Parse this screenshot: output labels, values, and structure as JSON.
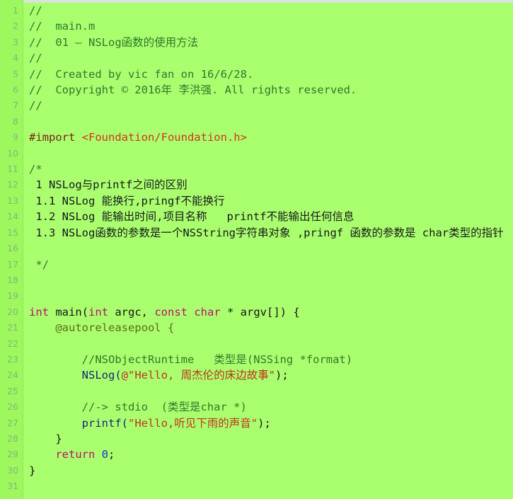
{
  "app": {
    "kind": "code-editor",
    "language": "Objective-C",
    "filename": "main.m"
  },
  "theme": {
    "background": "#aaff6e",
    "gutter_background": "#9cf85c",
    "gutter_rule": "#8fe854",
    "line_number_color": "#86b581",
    "top_strip": "#d9e3da",
    "comment": "#2b7a2b",
    "block_doc_text": "#16181a",
    "preprocessor": "#7a1f12",
    "header_path": "#d2341a",
    "keyword": "#b5116b",
    "function": "#13277a",
    "string": "#c0321c",
    "at_directive": "#5c6b18",
    "number": "#1232c8",
    "plain": "#141414"
  },
  "editor": {
    "first_visible_line": 1,
    "last_visible_line": 31,
    "lines": [
      {
        "n": "1",
        "tokens": [
          {
            "c": "t-comment",
            "t": "//"
          }
        ]
      },
      {
        "n": "2",
        "tokens": [
          {
            "c": "t-comment",
            "t": "//  main.m"
          }
        ]
      },
      {
        "n": "3",
        "tokens": [
          {
            "c": "t-comment",
            "t": "//  01 – NSLog函数的使用方法"
          }
        ]
      },
      {
        "n": "4",
        "tokens": [
          {
            "c": "t-comment",
            "t": "//"
          }
        ]
      },
      {
        "n": "5",
        "tokens": [
          {
            "c": "t-comment",
            "t": "//  Created by vic fan on 16/6/28."
          }
        ]
      },
      {
        "n": "6",
        "tokens": [
          {
            "c": "t-comment",
            "t": "//  Copyright © 2016年 李洪强. All rights reserved."
          }
        ]
      },
      {
        "n": "7",
        "tokens": [
          {
            "c": "t-comment",
            "t": "//"
          }
        ]
      },
      {
        "n": "8",
        "tokens": []
      },
      {
        "n": "9",
        "tokens": [
          {
            "c": "t-pre",
            "t": "#import "
          },
          {
            "c": "t-hdr",
            "t": "<Foundation/Foundation.h>"
          }
        ]
      },
      {
        "n": "10",
        "tokens": []
      },
      {
        "n": "11",
        "tokens": [
          {
            "c": "t-comment",
            "t": "/*"
          }
        ]
      },
      {
        "n": "12",
        "tokens": [
          {
            "c": "t-blockdoc",
            "t": " 1 NSLog与printf之间的区别"
          }
        ]
      },
      {
        "n": "13",
        "tokens": [
          {
            "c": "t-blockdoc",
            "t": " 1.1 NSLog 能换行,pringf不能换行"
          }
        ]
      },
      {
        "n": "14",
        "tokens": [
          {
            "c": "t-blockdoc",
            "t": " 1.2 NSLog 能输出时间,项目名称   printf不能输出任何信息"
          }
        ]
      },
      {
        "n": "15",
        "tokens": [
          {
            "c": "t-blockdoc",
            "t": " 1.3 NSLog函数的参数是一个NSString字符串对象 ,pringf 函数的参数是 char类型的指针"
          }
        ],
        "wraps": true
      },
      {
        "n": "16",
        "tokens": []
      },
      {
        "n": "17",
        "tokens": [
          {
            "c": "t-comment",
            "t": " */"
          }
        ]
      },
      {
        "n": "18",
        "tokens": []
      },
      {
        "n": "19",
        "tokens": []
      },
      {
        "n": "20",
        "tokens": [
          {
            "c": "t-kw",
            "t": "int"
          },
          {
            "c": "t-plain",
            "t": " main("
          },
          {
            "c": "t-kw",
            "t": "int"
          },
          {
            "c": "t-plain",
            "t": " argc, "
          },
          {
            "c": "t-kw",
            "t": "const"
          },
          {
            "c": "t-plain",
            "t": " "
          },
          {
            "c": "t-kw",
            "t": "char"
          },
          {
            "c": "t-plain",
            "t": " * argv[]) {"
          }
        ]
      },
      {
        "n": "21",
        "tokens": [
          {
            "c": "t-at",
            "t": "    @autoreleasepool {"
          }
        ]
      },
      {
        "n": "22",
        "tokens": []
      },
      {
        "n": "23",
        "tokens": [
          {
            "c": "t-comment",
            "t": "        //NSObjectRuntime   类型是(NSSing *format)"
          }
        ]
      },
      {
        "n": "24",
        "tokens": [
          {
            "c": "t-fn",
            "t": "        NSLog("
          },
          {
            "c": "t-str",
            "t": "@\"Hello, 周杰伦的床边故事\""
          },
          {
            "c": "t-plain",
            "t": ");"
          }
        ]
      },
      {
        "n": "25",
        "tokens": []
      },
      {
        "n": "26",
        "tokens": [
          {
            "c": "t-comment",
            "t": "        //-> stdio  (类型是char *)"
          }
        ]
      },
      {
        "n": "27",
        "tokens": [
          {
            "c": "t-fn",
            "t": "        printf("
          },
          {
            "c": "t-str",
            "t": "\"Hello,听见下雨的声音\""
          },
          {
            "c": "t-plain",
            "t": ");"
          }
        ]
      },
      {
        "n": "28",
        "tokens": [
          {
            "c": "t-plain",
            "t": "    }"
          }
        ]
      },
      {
        "n": "29",
        "tokens": [
          {
            "c": "t-kw",
            "t": "    return "
          },
          {
            "c": "t-num",
            "t": "0"
          },
          {
            "c": "t-plain",
            "t": ";"
          }
        ]
      },
      {
        "n": "30",
        "tokens": [
          {
            "c": "t-plain",
            "t": "}"
          }
        ]
      },
      {
        "n": "31",
        "tokens": []
      }
    ]
  }
}
